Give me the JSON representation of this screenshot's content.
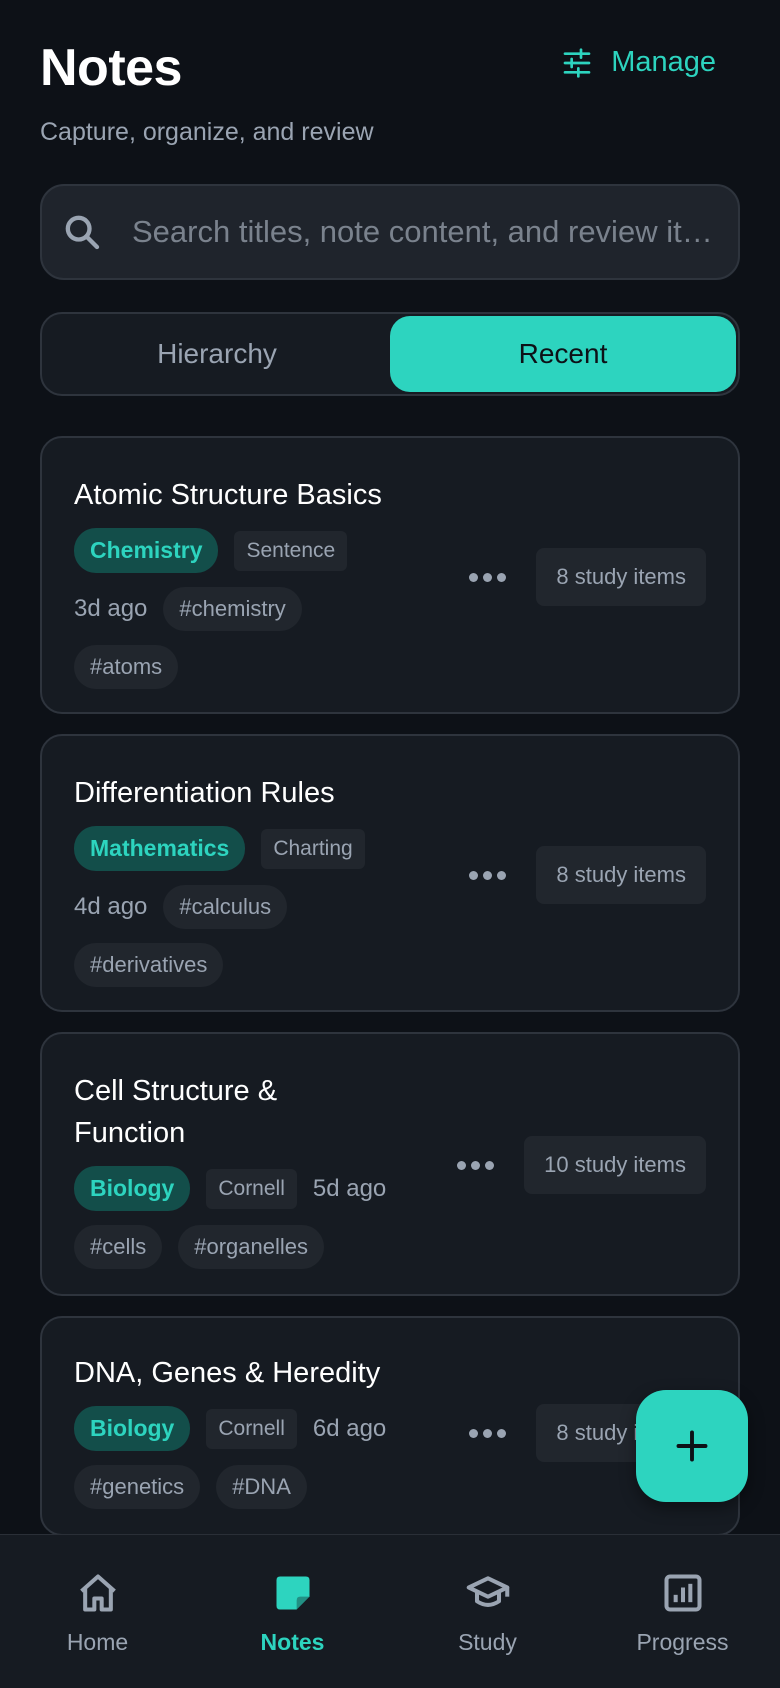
{
  "header": {
    "title": "Notes",
    "subtitle": "Capture, organize, and review",
    "manage_label": "Manage"
  },
  "search": {
    "placeholder": "Search titles, note content, and review items",
    "value": ""
  },
  "tabs": [
    {
      "label": "Hierarchy",
      "active": false
    },
    {
      "label": "Recent",
      "active": true
    }
  ],
  "notes": [
    {
      "title": "Atomic Structure Basics",
      "subject": "Chemistry",
      "method": "Sentence",
      "time": "3d ago",
      "tags": [
        "#chemistry",
        "#atoms"
      ],
      "study_items": "8 study items"
    },
    {
      "title": "Differentiation Rules",
      "subject": "Mathematics",
      "method": "Charting",
      "time": "4d ago",
      "tags": [
        "#calculus",
        "#derivatives"
      ],
      "study_items": "8 study items"
    },
    {
      "title": "Cell Structure & Function",
      "subject": "Biology",
      "method": "Cornell",
      "time": "5d ago",
      "tags": [
        "#cells",
        "#organelles"
      ],
      "study_items": "10 study items"
    },
    {
      "title": "DNA, Genes & Heredity",
      "subject": "Biology",
      "method": "Cornell",
      "time": "6d ago",
      "tags": [
        "#genetics",
        "#DNA"
      ],
      "study_items": "8 study items"
    }
  ],
  "fab": {
    "icon": "plus-icon"
  },
  "nav": [
    {
      "label": "Home",
      "icon": "home-icon",
      "active": false
    },
    {
      "label": "Notes",
      "icon": "note-icon",
      "active": true
    },
    {
      "label": "Study",
      "icon": "graduation-cap-icon",
      "active": false
    },
    {
      "label": "Progress",
      "icon": "bar-chart-icon",
      "active": false
    }
  ],
  "colors": {
    "background": "#0d1117",
    "card": "#161b22",
    "accent": "#2dd4bf",
    "muted_text": "#9aa4b2"
  }
}
